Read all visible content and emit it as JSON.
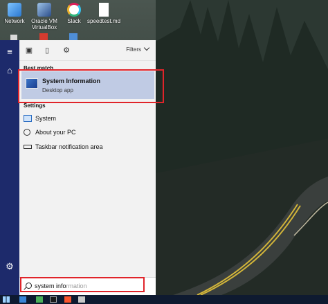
{
  "desktop": {
    "icons": [
      {
        "label_line1": "Network",
        "label_line2": "",
        "icon": "network-icon"
      },
      {
        "label_line1": "Oracle VM",
        "label_line2": "VirtualBox",
        "icon": "virtualbox-icon"
      },
      {
        "label_line1": "Slack",
        "label_line2": "",
        "icon": "slack-icon"
      },
      {
        "label_line1": "speedtest.md",
        "label_line2": "",
        "icon": "file-icon"
      }
    ]
  },
  "search_panel": {
    "filters_label": "Filters",
    "best_match_heading": "Best match",
    "best_match": {
      "title": "System Information",
      "subtitle": "Desktop app"
    },
    "settings_heading": "Settings",
    "settings_items": [
      {
        "label": "System",
        "icon": "monitor-icon"
      },
      {
        "label": "About your PC",
        "icon": "info-icon"
      },
      {
        "label": "Taskbar notification area",
        "icon": "taskbar-icon"
      }
    ]
  },
  "search_box": {
    "typed": "system info",
    "ghost": "rmation"
  },
  "colors": {
    "rail": "#1d2a6b",
    "highlight": "#c0cbe4",
    "annotation": "#e0242a"
  }
}
